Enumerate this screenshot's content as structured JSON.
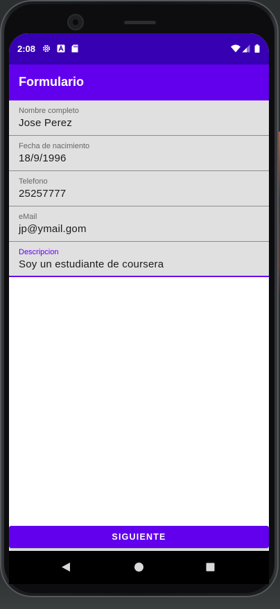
{
  "status_bar": {
    "time": "2:08",
    "icons": [
      "gear-icon",
      "a-badge-icon",
      "sd-card-icon",
      "wifi-icon",
      "signal-icon",
      "battery-icon"
    ]
  },
  "app_bar": {
    "title": "Formulario"
  },
  "form": {
    "fields": [
      {
        "label": "Nombre completo",
        "value": "Jose Perez"
      },
      {
        "label": "Fecha de nacimiento",
        "value": "18/9/1996"
      },
      {
        "label": "Telefono",
        "value": "25257777"
      },
      {
        "label": "eMail",
        "value": "jp@ymail.gom"
      },
      {
        "label": "Descripcion",
        "value": "Soy un estudiante de coursera"
      }
    ]
  },
  "actions": {
    "next_label": "SIGUIENTE"
  },
  "colors": {
    "primary": "#6200ee",
    "primary_dark": "#3700b3",
    "field_bg": "#e0e0e0"
  },
  "nav_bar": {
    "icons": [
      "back-icon",
      "home-icon",
      "recents-icon"
    ]
  }
}
